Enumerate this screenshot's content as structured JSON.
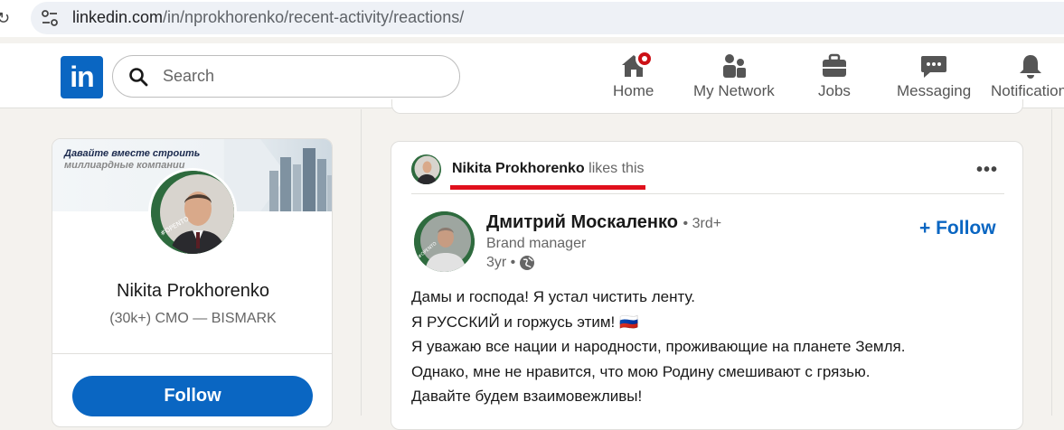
{
  "browser": {
    "url_host": "linkedin.com",
    "url_path": "/in/nprokhorenko/recent-activity/reactions/"
  },
  "header": {
    "logo": "in",
    "search_placeholder": "Search",
    "nav": [
      {
        "label": "Home",
        "icon": "home-icon"
      },
      {
        "label": "My Network",
        "icon": "network-icon"
      },
      {
        "label": "Jobs",
        "icon": "briefcase-icon"
      },
      {
        "label": "Messaging",
        "icon": "messaging-icon"
      },
      {
        "label": "Notifications",
        "icon": "bell-icon"
      }
    ]
  },
  "profile": {
    "banner_text_line1": "Давайте вместе строить",
    "banner_text_line2": "миллиардные компании",
    "name": "Nikita Prokhorenko",
    "headline": "(30k+) CMO — BISMARK",
    "follow_label": "Follow",
    "avatar_frame": "#OPENTOWORK"
  },
  "post": {
    "context_name": "Nikita Prokhorenko",
    "context_action": "likes this",
    "author_name": "Дмитрий Москаленко",
    "author_degree": "• 3rd+",
    "author_title": "Brand manager",
    "author_time": "3yr •",
    "follow_label": "+ Follow",
    "body_lines": [
      "Дамы и господа! Я устал чистить ленту.",
      "Я РУССКИЙ и горжусь этим! 🇷🇺",
      "Я уважаю все нации и народности, проживающие на планете Земля.",
      "Однако, мне не нравится, что мою Родину смешивают с грязью.",
      "Давайте будем взаимовежливы!"
    ]
  },
  "colors": {
    "brand": "#0a66c2",
    "highlight_underline": "#e0101c",
    "opentowork_green": "#2e6b3e"
  }
}
